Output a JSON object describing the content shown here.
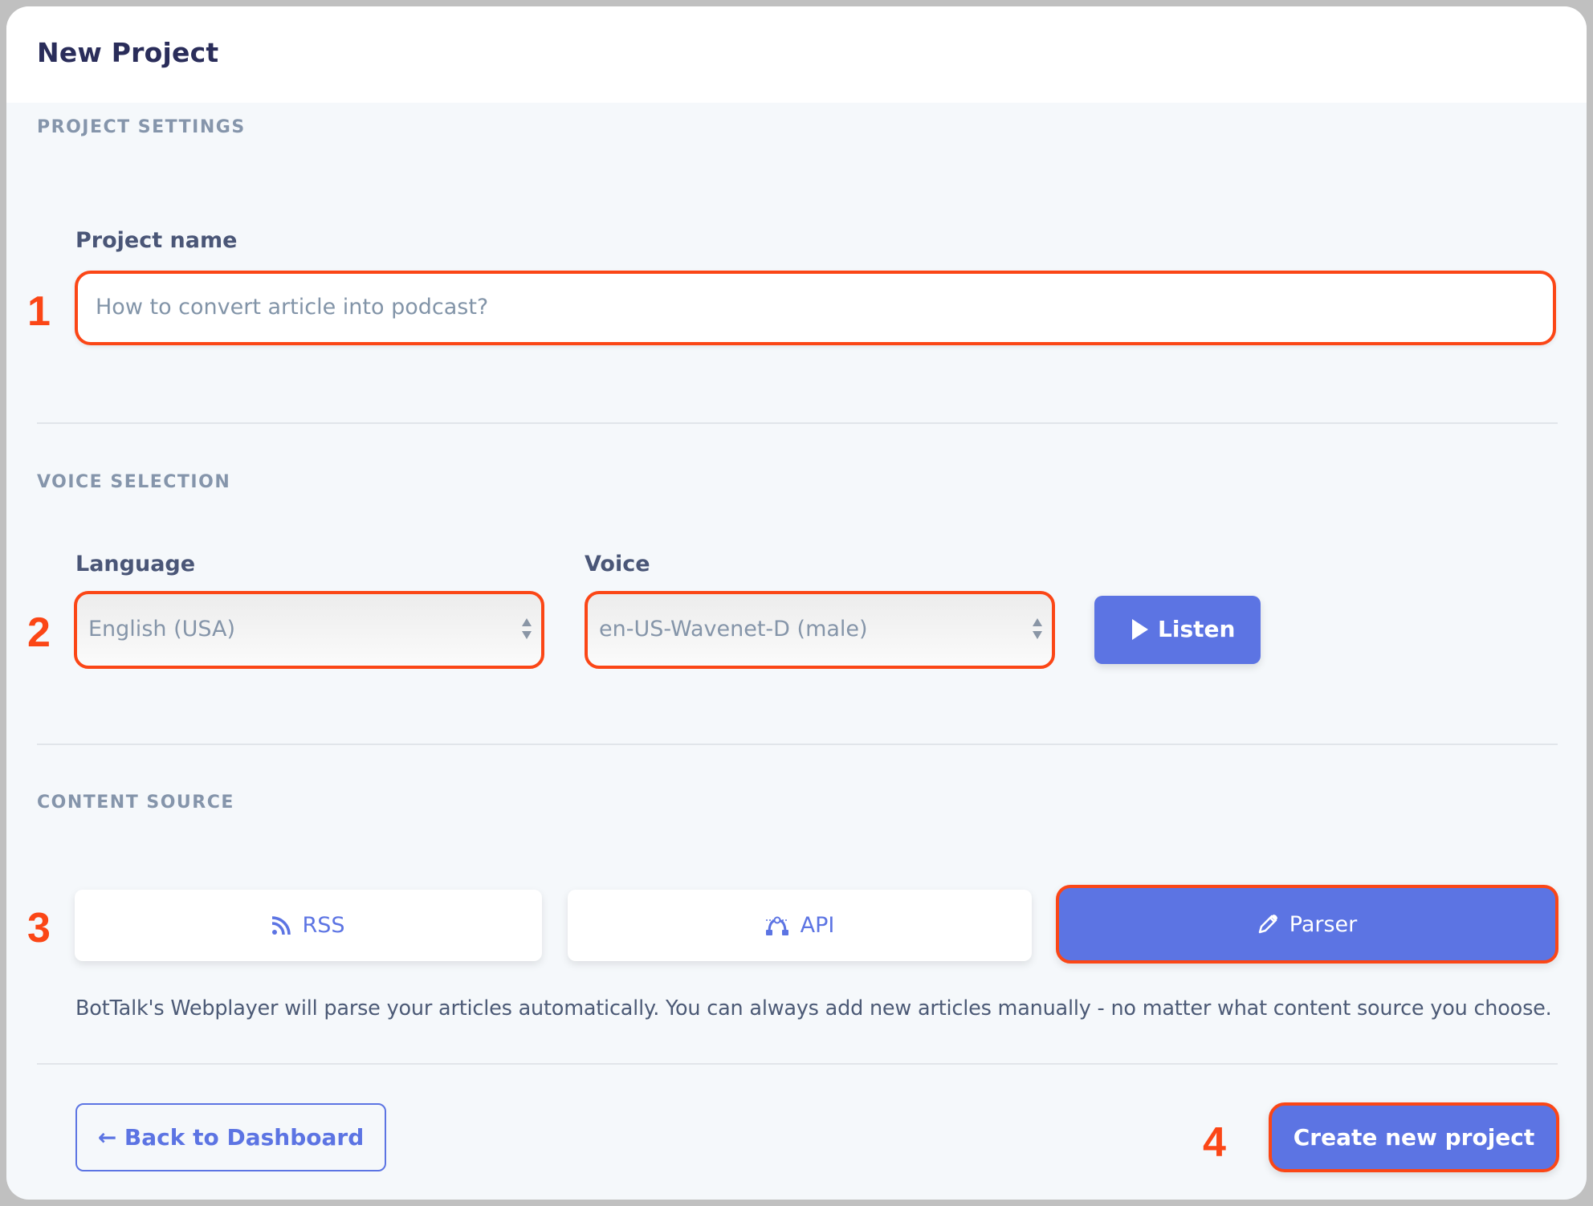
{
  "header": {
    "title": "New Project"
  },
  "sections": {
    "project_settings": {
      "label": "PROJECT SETTINGS",
      "project_name_label": "Project name",
      "project_name_placeholder": "How to convert article into podcast?"
    },
    "voice_selection": {
      "label": "VOICE SELECTION",
      "language_label": "Language",
      "language_value": "English (USA)",
      "voice_label": "Voice",
      "voice_value": "en-US-Wavenet-D (male)",
      "listen_label": "Listen"
    },
    "content_source": {
      "label": "CONTENT SOURCE",
      "options": [
        {
          "label": "RSS",
          "icon": "rss-icon",
          "selected": false
        },
        {
          "label": "API",
          "icon": "bezier-curve-icon",
          "selected": false
        },
        {
          "label": "Parser",
          "icon": "pencil-icon",
          "selected": true
        }
      ],
      "description": "BotTalk's Webplayer will parse your articles automatically. You can always add new articles manually - no matter what content source you choose."
    }
  },
  "footer": {
    "back_label": "← Back to Dashboard",
    "create_label": "Create new project"
  },
  "annotations": [
    "1",
    "2",
    "3",
    "4"
  ],
  "colors": {
    "accent": "#5c74e3",
    "annotation": "#fb4616",
    "title": "#2a2d5a",
    "section_label": "#8595ab",
    "background": "#f5f8fb"
  }
}
